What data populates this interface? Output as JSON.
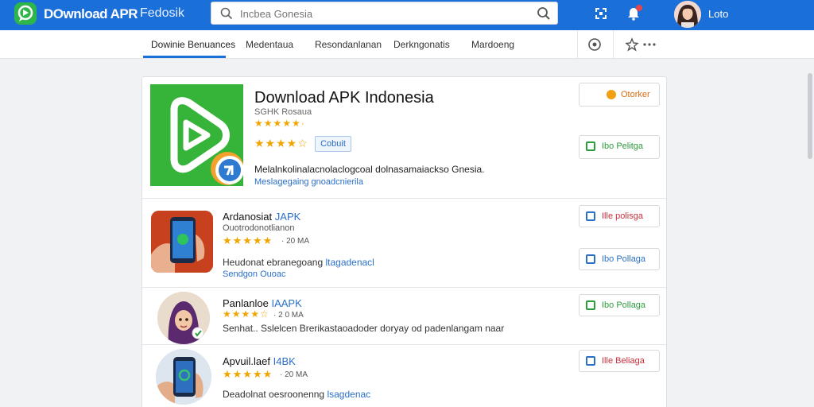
{
  "topbar": {
    "brand": "DOwnload APR",
    "brand_sub": "Fedosik",
    "search_placeholder": "Incbea Gonesia",
    "user_name": "Loto",
    "colors": {
      "bar": "#1b6fd9",
      "accent_green": "#2fb64b"
    },
    "icons": [
      "search-icon",
      "expand-icon",
      "bell-icon"
    ]
  },
  "nav": {
    "tabs": [
      "Dowinie Benuances",
      "Medentaua",
      "Resondanlanan",
      "Derkngonatis",
      "Mardoeng"
    ],
    "active_tab": 0,
    "icons": [
      "compass-icon",
      "pin-icon",
      "more-icon"
    ]
  },
  "hero": {
    "title": "Download APK Indonesia",
    "meta": "SGHK Rosaua",
    "stars_small": "★★★★★·",
    "stars_large": "★★★★☆",
    "chip": "Cobuit",
    "description": "Melalnkolinalacnolaclogcoal dolnasamaiackso Gnesia.",
    "link": "Meslagegaing gnoadcnierila",
    "button_top": "Otorker",
    "button_green": "Ibo Pelitga"
  },
  "apps": [
    {
      "title": "Ardanosiat",
      "tag": "JAPK",
      "subtitle": "Ouotrodonotlianon",
      "stars": "★★★★★",
      "size": "· 20 MA",
      "description": "Heudonat ebranegoang",
      "description_tag": "ltagadenacl",
      "link": "Sendgon Ouoac",
      "button_red": "Ille polisga",
      "button_blue": "Ibo Pollaga"
    },
    {
      "title": "Panlanloe",
      "tag": "IAAPK",
      "stars": "★★★★☆",
      "size": "· 2 0 MA",
      "description": "Senhat.. Sslelcen Brerikastaoadoder doryay od padenlangam naar",
      "button_green": "Ibo Pollaga"
    },
    {
      "title": "Apvuil.laef",
      "tag": "I4BK",
      "stars": "★★★★★",
      "size": "· 20 MA",
      "description": "Deadolnat oesroonenng",
      "description_tag": "lsagdenac",
      "button_red": "Ille Beliaga"
    }
  ]
}
